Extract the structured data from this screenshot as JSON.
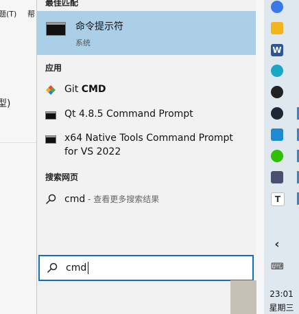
{
  "background": {
    "menu_left": "题(T)",
    "menu_right": "帮",
    "side_text": "型)"
  },
  "start": {
    "best_match_header": "最佳匹配",
    "best_match": {
      "title": "命令提示符",
      "subtitle": "系统",
      "icon": "cmd-icon"
    },
    "apps_header": "应用",
    "apps": [
      {
        "label_prefix": "Git ",
        "label_bold": "CMD",
        "icon": "git-icon"
      },
      {
        "label": "Qt 4.8.5 Command Prompt",
        "icon": "cmd-icon"
      },
      {
        "label_line1": "x64 Native Tools Command Prompt",
        "label_line2": "for VS 2022",
        "icon": "cmd-icon"
      }
    ],
    "web_header": "搜索网页",
    "web": {
      "term": "cmd",
      "suffix": " - 查看更多搜索结果",
      "icon": "search-icon"
    },
    "search": {
      "value": "cmd",
      "icon": "search-icon"
    }
  },
  "taskbar": {
    "icons": [
      "chrome-icon",
      "file-explorer-icon",
      "word-icon",
      "edge-icon",
      "qq-icon",
      "steam-icon",
      "vscode-icon",
      "wechat-icon",
      "app-icon",
      "typora-icon"
    ],
    "chevron": "‹",
    "time": "23:01",
    "day": "星期三"
  },
  "colors": {
    "accent": "#0f6ec7",
    "selected": "#accfe8",
    "panel": "#f2f2f2"
  }
}
